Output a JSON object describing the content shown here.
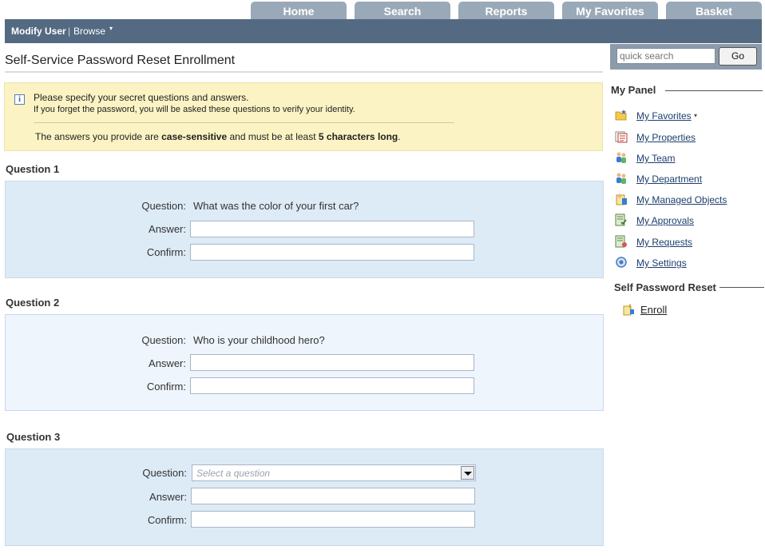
{
  "tabs": [
    "Home",
    "Search",
    "Reports",
    "My Favorites",
    "Basket"
  ],
  "nav": {
    "modify_user": "Modify User",
    "separator": "|",
    "browse": "Browse",
    "browse_caret": "▾"
  },
  "page_title": "Self-Service Password Reset Enrollment",
  "info": {
    "line1": "Please specify your secret questions and answers.",
    "line2": "If you forget the password, you will be asked these questions to verify your identity.",
    "line3_pre": "The answers you provide are ",
    "line3_bold1": "case-sensitive",
    "line3_mid": " and must be at least ",
    "line3_bold2": "5 characters long",
    "line3_post": "."
  },
  "labels": {
    "question": "Question:",
    "answer": "Answer:",
    "confirm": "Confirm:"
  },
  "questions": [
    {
      "heading": "Question 1",
      "question_text": "What was the color of your first car?",
      "answer": "",
      "confirm": ""
    },
    {
      "heading": "Question 2",
      "question_text": "Who is your childhood hero?",
      "answer": "",
      "confirm": ""
    },
    {
      "heading": "Question 3",
      "select_placeholder": "Select a question",
      "answer": "",
      "confirm": ""
    }
  ],
  "search": {
    "placeholder": "quick search",
    "go_label": "Go"
  },
  "my_panel": {
    "title": "My Panel",
    "items": [
      {
        "label": "My Favorites",
        "icon": "folder-star-icon",
        "has_caret": true
      },
      {
        "label": "My Properties",
        "icon": "properties-icon"
      },
      {
        "label": "My Team",
        "icon": "team-icon"
      },
      {
        "label": "My Department",
        "icon": "department-icon"
      },
      {
        "label": "My Managed Objects",
        "icon": "managed-objects-icon"
      },
      {
        "label": "My Approvals",
        "icon": "approvals-icon"
      },
      {
        "label": "My Requests",
        "icon": "requests-icon"
      },
      {
        "label": "My Settings",
        "icon": "settings-icon"
      }
    ],
    "caret": "▾"
  },
  "self_password_reset": {
    "title": "Self Password Reset",
    "enroll_label": "Enroll",
    "enroll_icon": "enroll-icon"
  },
  "colors": {
    "navbar": "#546a82",
    "tab": "#9aa9b8",
    "info_bg": "#fbf3c3",
    "panel_dark": "#ddebf7",
    "panel_light": "#eef5fc",
    "link": "#1d3f6e"
  }
}
